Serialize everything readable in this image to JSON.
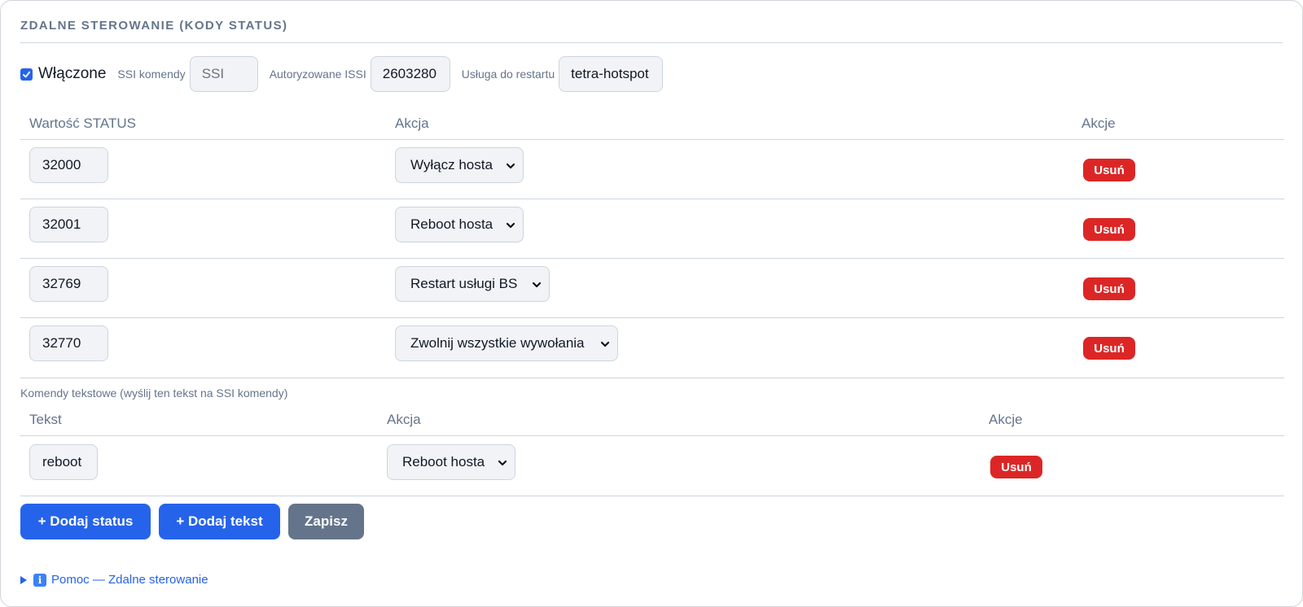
{
  "section": {
    "title": "ZDALNE STEROWANIE (KODY STATUS)"
  },
  "toolbar": {
    "enabled_label": "Włączone",
    "enabled_checked": true,
    "ssi_label": "SSI komendy",
    "ssi_placeholder": "SSI",
    "issi_label": "Autoryzowane ISSI",
    "issi_value": "2603280",
    "service_label": "Usługa do restartu",
    "service_value": "tetra-hotspot"
  },
  "status_table": {
    "headers": {
      "value": "Wartość STATUS",
      "action": "Akcja",
      "actions": "Akcje"
    },
    "rows": [
      {
        "value": "32000",
        "action": "Wyłącz hosta",
        "delete": "Usuń"
      },
      {
        "value": "32001",
        "action": "Reboot hosta",
        "delete": "Usuń"
      },
      {
        "value": "32769",
        "action": "Restart usługi BS",
        "delete": "Usuń"
      },
      {
        "value": "32770",
        "action": "Zwolnij wszystkie wywołania",
        "delete": "Usuń"
      }
    ]
  },
  "text_commands": {
    "label": "Komendy tekstowe (wyślij ten tekst na SSI komendy)",
    "headers": {
      "text": "Tekst",
      "action": "Akcja",
      "actions": "Akcje"
    },
    "rows": [
      {
        "text": "reboot",
        "action": "Reboot hosta",
        "delete": "Usuń"
      }
    ]
  },
  "buttons": {
    "add_status": "+ Dodaj status",
    "add_text": "+ Dodaj tekst",
    "save": "Zapisz"
  },
  "help": {
    "label": "Pomoc — Zdalne sterowanie",
    "icon": "info-icon"
  },
  "colors": {
    "accent": "#2563eb",
    "danger": "#dc2626",
    "muted": "#64748b"
  }
}
